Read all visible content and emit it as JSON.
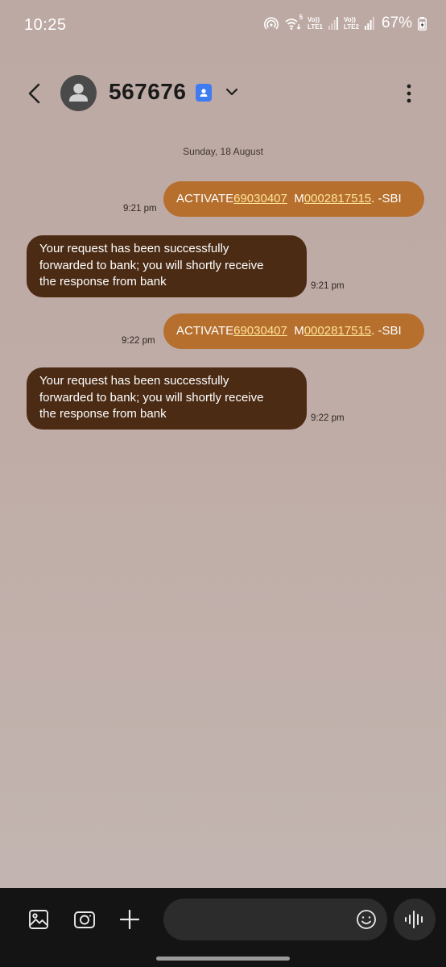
{
  "status_bar": {
    "time": "10:25",
    "network_1": {
      "top": "Vo))",
      "bottom": "LTE1"
    },
    "network_2": {
      "top": "Vo))",
      "bottom": "LTE2"
    },
    "wifi_badge": "5",
    "battery": "67%"
  },
  "header": {
    "contact": "567676"
  },
  "conversation": {
    "date": "Sunday, 18 August",
    "messages": [
      {
        "direction": "sent",
        "parts": [
          "ACTIVATE ",
          "69030407",
          "  M",
          "0002817515",
          ". -SBI"
        ],
        "time": "9:21 pm"
      },
      {
        "direction": "received",
        "lines": [
          "Your request has been successfully",
          "forwarded to bank; you will shortly receive",
          "the response from bank"
        ],
        "time": "9:21 pm"
      },
      {
        "direction": "sent",
        "parts": [
          "ACTIVATE ",
          "69030407",
          "  M",
          "0002817515",
          ". -SBI"
        ],
        "time": "9:22 pm"
      },
      {
        "direction": "received",
        "lines": [
          "Your request has been successfully",
          "forwarded to bank; you will shortly receive",
          "the response from bank"
        ],
        "time": "9:22 pm"
      }
    ]
  },
  "compose": {
    "placeholder": ""
  },
  "colors": {
    "sent_bubble": "#b66f2d",
    "received_bubble": "#4b2b14",
    "link": "#ffe49a",
    "contact_badge": "#3f7bf0"
  }
}
